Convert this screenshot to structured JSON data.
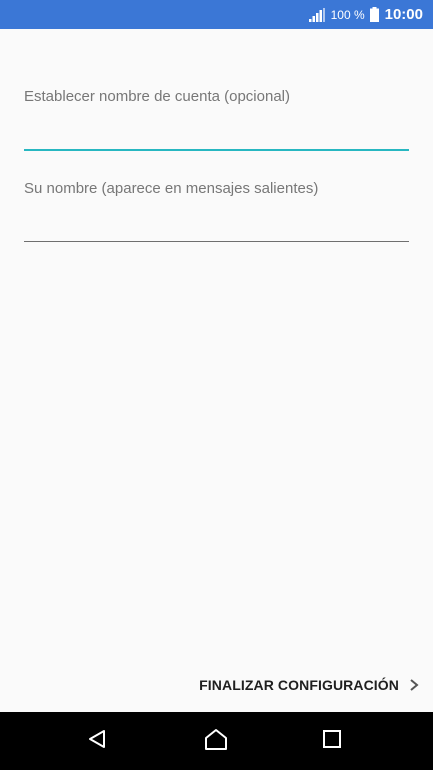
{
  "status_bar": {
    "battery_percent": "100 %",
    "time": "10:00",
    "color": "#3b77d6",
    "icons": [
      "signal-icon",
      "battery-icon"
    ]
  },
  "form": {
    "account_name": {
      "label": "Establecer nombre de cuenta (opcional)",
      "value": "",
      "focused": true,
      "underline_color": "#27b7c1"
    },
    "your_name": {
      "label": "Su nombre (aparece en mensajes salientes)",
      "value": "",
      "focused": false
    }
  },
  "actions": {
    "finish_label": "FINALIZAR CONFIGURACIÓN",
    "finish_icon": "chevron-right-icon"
  },
  "nav_bar": {
    "icons": [
      "back-icon",
      "home-icon",
      "recent-apps-icon"
    ]
  }
}
